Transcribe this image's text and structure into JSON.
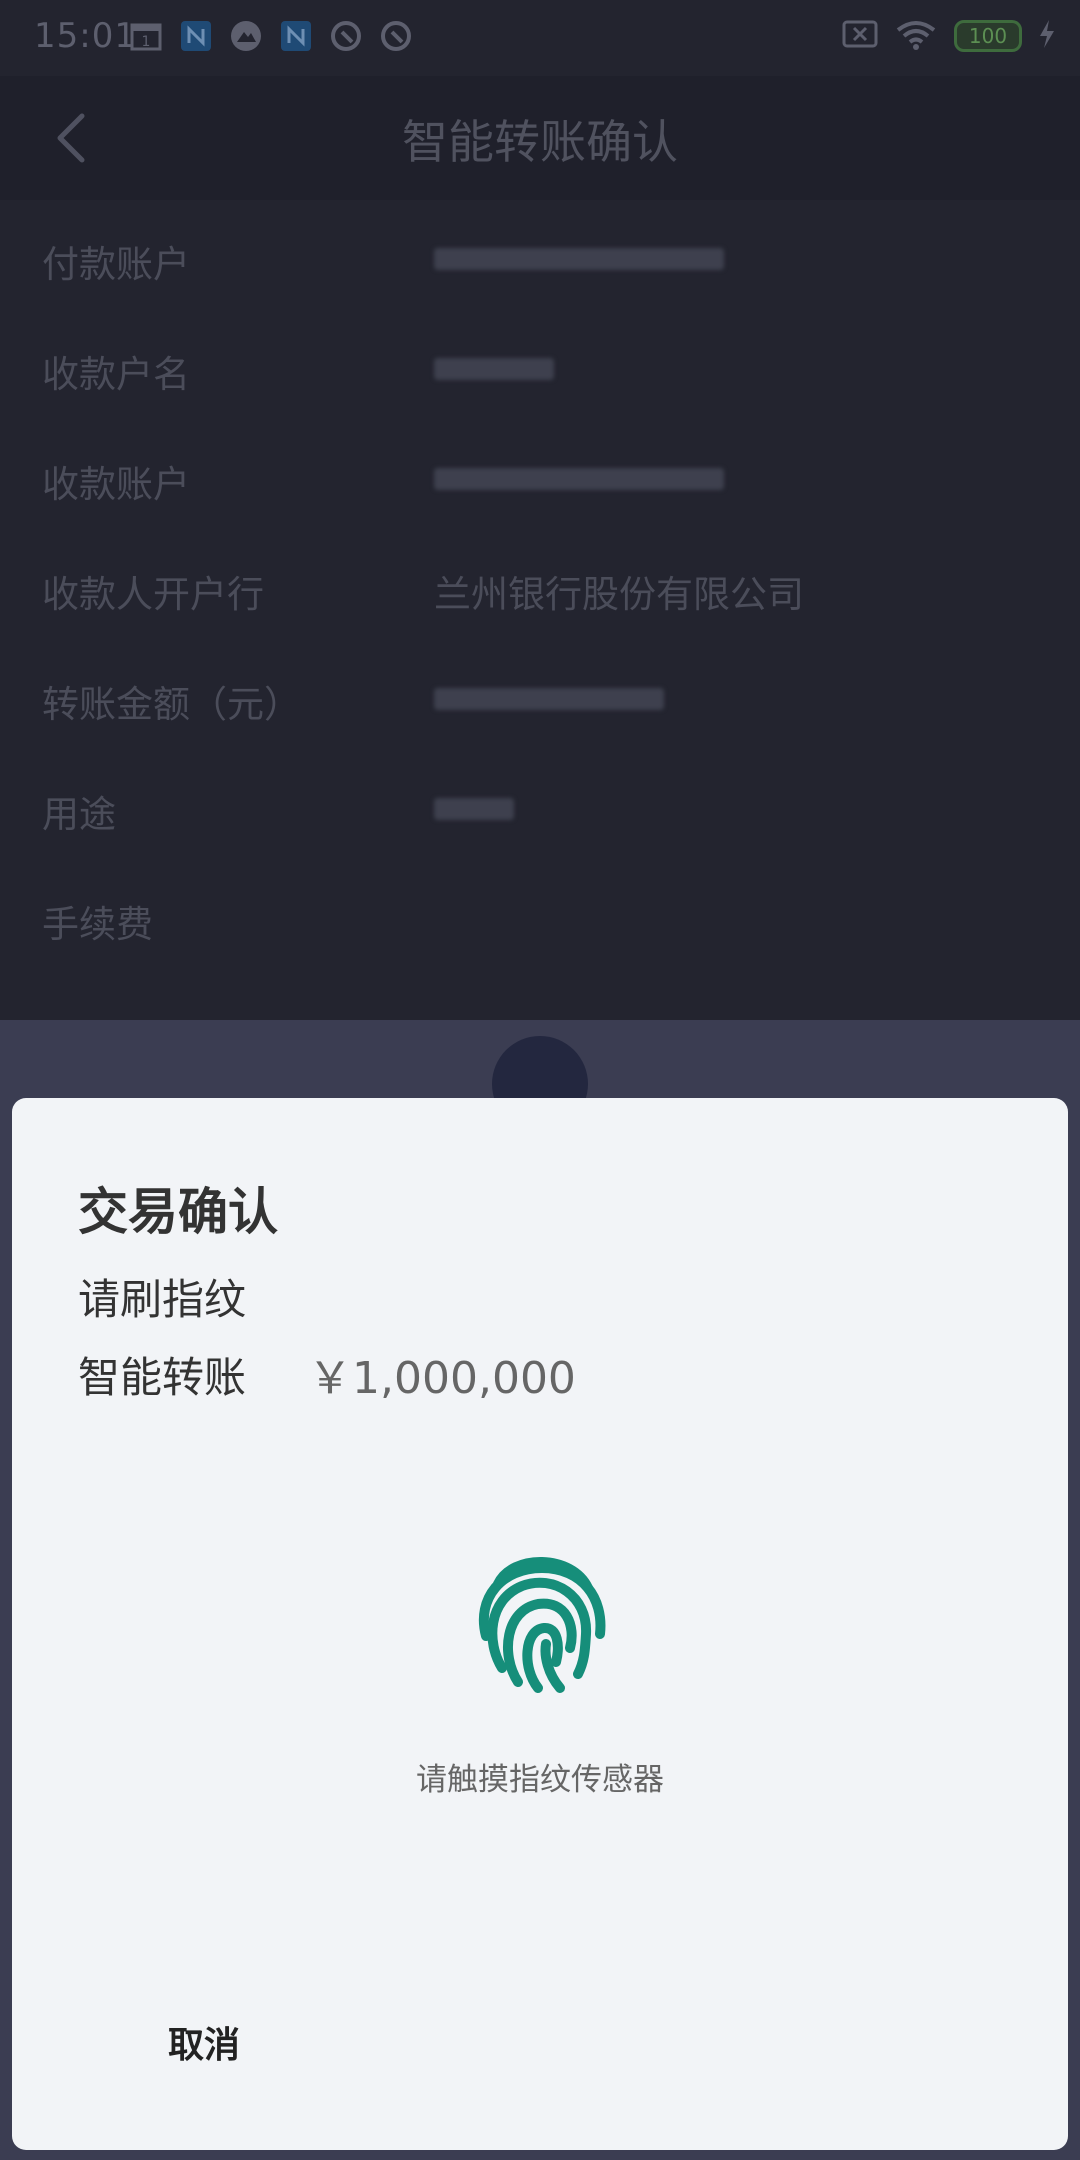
{
  "status_bar": {
    "time": "15:01",
    "calendar_day": "1",
    "battery": "100",
    "icons": [
      "calendar-icon",
      "n-app-icon",
      "mountain-app-icon",
      "n-app-icon",
      "q-app-icon",
      "q-app-icon",
      "sim-off-icon",
      "wifi-icon",
      "battery-icon",
      "charging-icon"
    ]
  },
  "header": {
    "title": "智能转账确认"
  },
  "details": {
    "rows": [
      {
        "label": "付款账户",
        "value": ""
      },
      {
        "label": "收款户名",
        "value": ""
      },
      {
        "label": "收款账户",
        "value": ""
      },
      {
        "label": "收款人开户行",
        "value": "兰州银行股份有限公司"
      },
      {
        "label": "转账金额（元）",
        "value": ""
      },
      {
        "label": "用途",
        "value": ""
      },
      {
        "label": "手续费",
        "value": ""
      }
    ]
  },
  "sheet": {
    "title": "交易确认",
    "subtitle": "请刷指纹",
    "business": "智能转账",
    "amount": "￥1,000,000",
    "fingerprint_hint": "请触摸指纹传感器",
    "cancel_label": "取消"
  },
  "colors": {
    "accent": "#168e7a",
    "sheet_bg": "#f2f4f7",
    "overlay_bg": "#23242f"
  }
}
